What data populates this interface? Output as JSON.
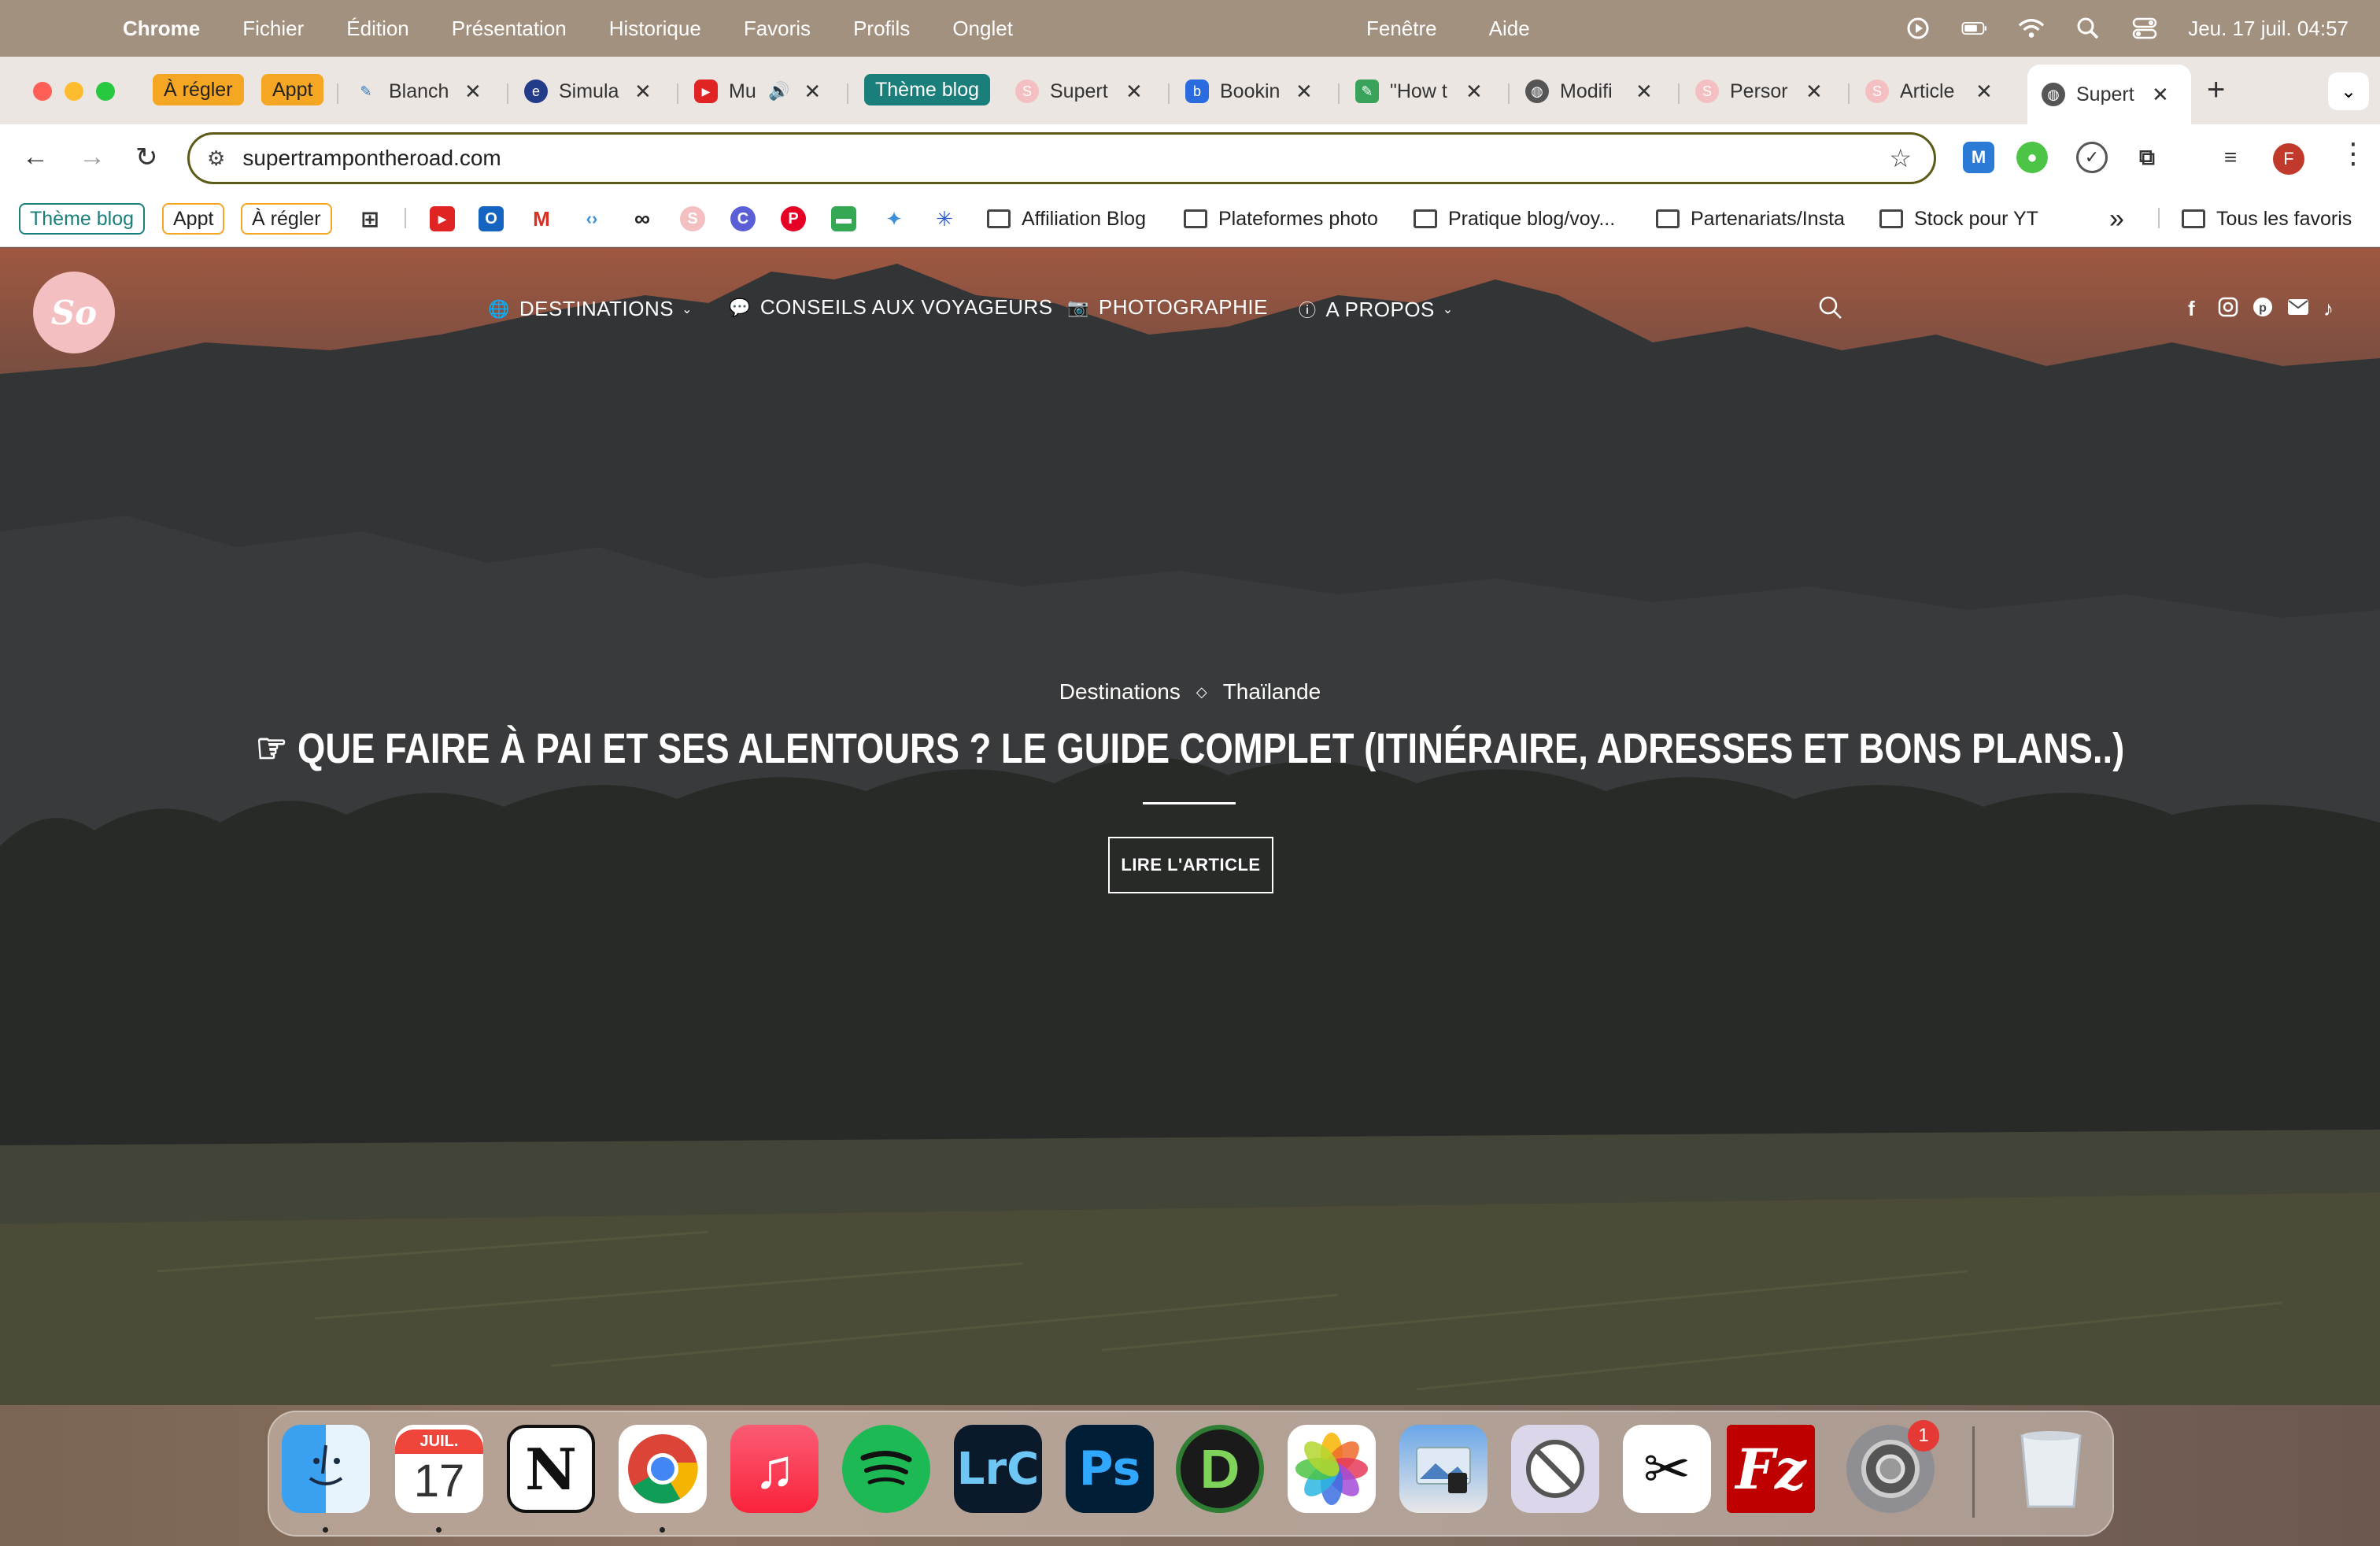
{
  "menubar": {
    "app": "Chrome",
    "items": [
      "Fichier",
      "Édition",
      "Présentation",
      "Historique",
      "Favoris",
      "Profils",
      "Onglet"
    ],
    "center_items": [
      "Fenêtre",
      "Aide"
    ],
    "clock": "Jeu. 17 juil.  04:57"
  },
  "tab_groups": [
    {
      "label": "À régler",
      "color": "#f5a623"
    },
    {
      "label": "Appt",
      "color": "#f5a623"
    },
    {
      "label": "Thème blog",
      "color": "#1a7f7a"
    }
  ],
  "tabs": [
    {
      "title": "Blanch",
      "fav_color": "#ffffff",
      "fav_glyph": "✎"
    },
    {
      "title": "Simula",
      "fav_color": "#233c8a",
      "fav_glyph": "e"
    },
    {
      "title": "Mu",
      "fav_color": "#e02424",
      "fav_glyph": "▶",
      "audio": "🔊"
    },
    {
      "title": "Supert",
      "fav_color": "#f3bfc1",
      "fav_glyph": "S"
    },
    {
      "title": "Bookin",
      "fav_color": "#2a6ce0",
      "fav_glyph": "b"
    },
    {
      "title": "\"How t",
      "fav_color": "#3aa35b",
      "fav_glyph": "✎"
    },
    {
      "title": "Modifi",
      "fav_color": "#555555",
      "fav_glyph": "◍"
    },
    {
      "title": "Persor",
      "fav_color": "#f3bfc1",
      "fav_glyph": "S"
    },
    {
      "title": "Article",
      "fav_color": "#f3bfc1",
      "fav_glyph": "S"
    },
    {
      "title": "Supert",
      "fav_color": "#555555",
      "fav_glyph": "◍"
    }
  ],
  "toolbar": {
    "url": "supertrampontheroad.com",
    "avatar_letter": "F"
  },
  "bookmarks": {
    "chips": [
      "Thème blog",
      "Appt",
      "À régler"
    ],
    "folders": [
      "Affiliation Blog",
      "Plateformes photo",
      "Pratique blog/voy...",
      "Partenariats/Insta",
      "Stock pour YT"
    ],
    "more": "»",
    "all": "Tous les favoris"
  },
  "site": {
    "logo_text": "So",
    "nav": [
      {
        "label": "DESTINATIONS",
        "icon": "🌐",
        "caret": "⌄"
      },
      {
        "label": "CONSEILS AUX VOYAGEURS",
        "icon": "💬",
        "caret": ""
      },
      {
        "label": "PHOTOGRAPHIE",
        "icon": "📷",
        "caret": ""
      },
      {
        "label": "A PROPOS",
        "icon": "ⓘ",
        "caret": "⌄"
      }
    ],
    "social_icons": [
      "facebook-icon",
      "instagram-icon",
      "pinterest-icon",
      "email-icon",
      "tiktok-icon"
    ],
    "breadcrumb": [
      "Destinations",
      "Thaïlande"
    ],
    "headline": "☞ QUE FAIRE À PAI ET SES ALENTOURS ? LE GUIDE COMPLET (ITINÉRAIRE, ADRESSES ET BONS PLANS..)",
    "cta": "LIRE L'ARTICLE"
  },
  "dock": {
    "calendar_month": "JUIL.",
    "calendar_day": "17",
    "settings_badge": "1"
  }
}
